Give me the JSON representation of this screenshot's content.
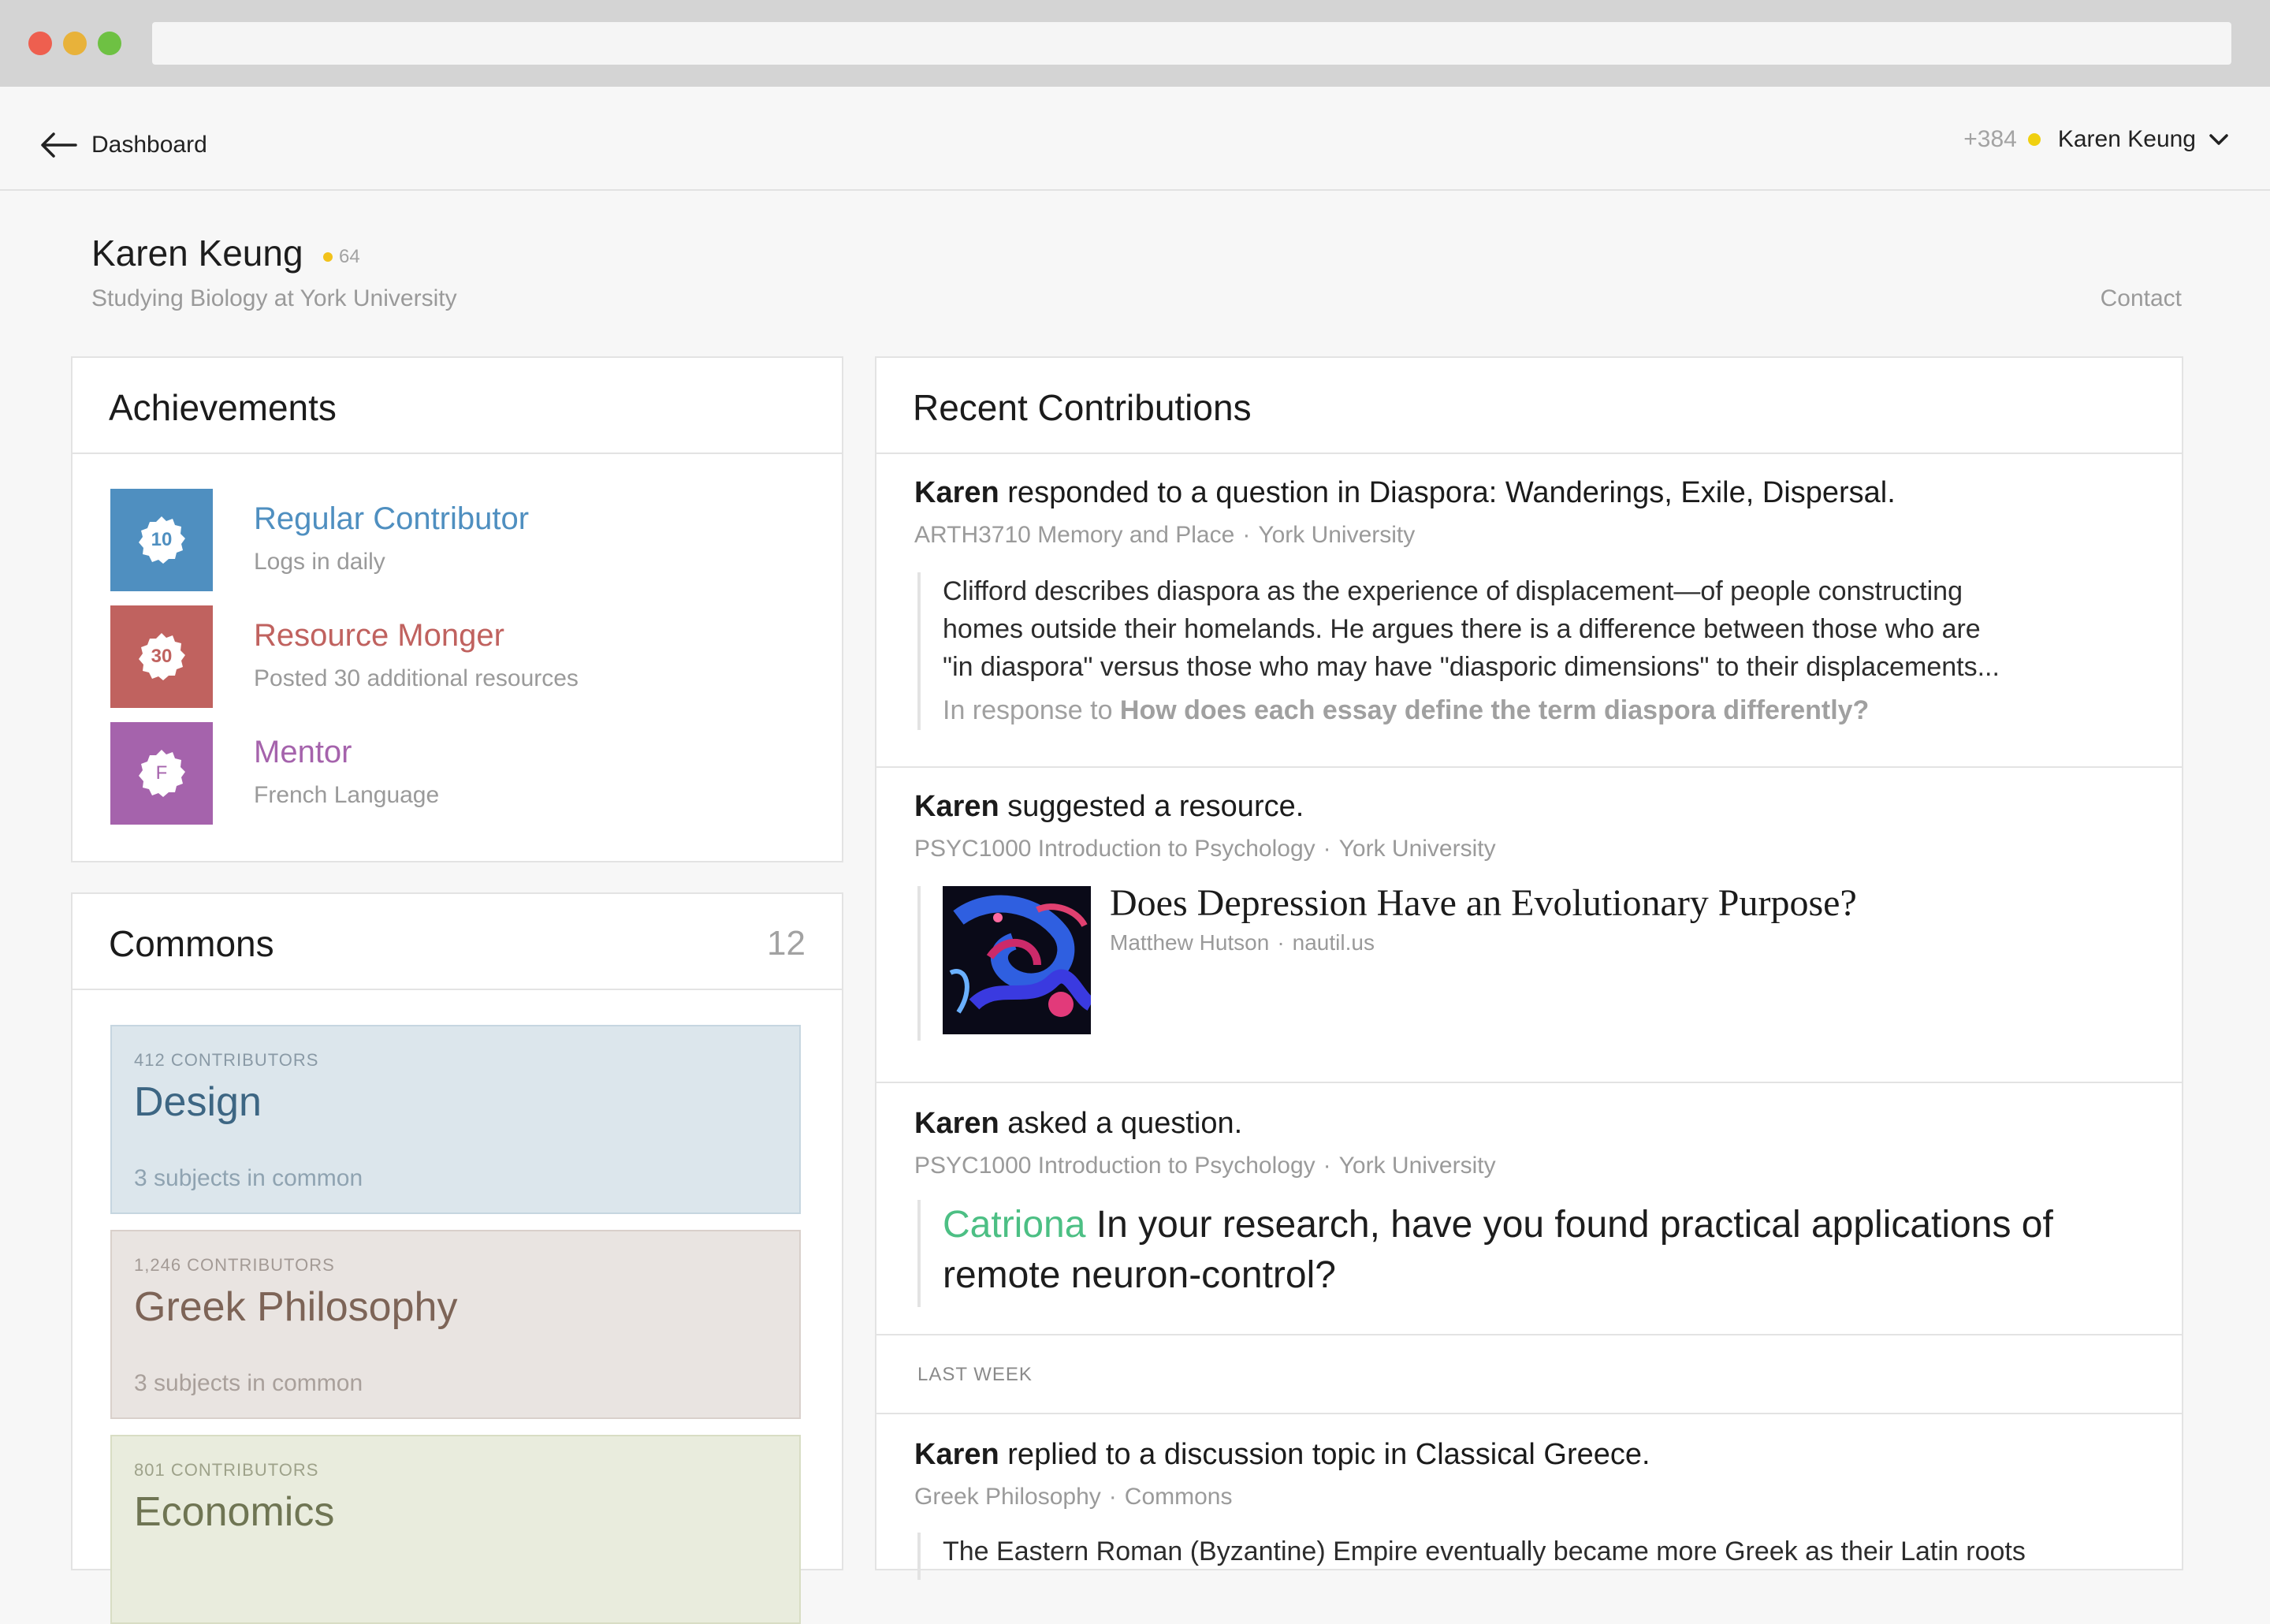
{
  "nav": {
    "back_label": "Dashboard",
    "points": "+384",
    "user_name": "Karen Keung"
  },
  "profile": {
    "name": "Karen Keung",
    "score": "64",
    "subtitle": "Studying Biology at York University",
    "contact_label": "Contact"
  },
  "achievements": {
    "title": "Achievements",
    "items": [
      {
        "badge": "10",
        "title": "Regular Contributor",
        "desc": "Logs in daily",
        "color": "#4f8fc0"
      },
      {
        "badge": "30",
        "title": "Resource Monger",
        "desc": "Posted 30 additional resources",
        "color": "#c0625f"
      },
      {
        "badge": "F",
        "title": "Mentor",
        "desc": "French Language",
        "color": "#a563ac"
      }
    ]
  },
  "commons": {
    "title": "Commons",
    "count": "12",
    "items": [
      {
        "contributors": "412 CONTRIBUTORS",
        "name": "Design",
        "sub": "3 subjects in common",
        "bg": "#dce6ec",
        "border": "#c6d6e0",
        "fg": "#3d6683"
      },
      {
        "contributors": "1,246 CONTRIBUTORS",
        "name": "Greek Philosophy",
        "sub": "3 subjects in common",
        "bg": "#e9e4e1",
        "border": "#d9d0cb",
        "fg": "#7d6457"
      },
      {
        "contributors": "801 CONTRIBUTORS",
        "name": "Economics",
        "sub": "",
        "bg": "#e9ecdd",
        "border": "#d8ddc4",
        "fg": "#6f7553"
      }
    ]
  },
  "contributions": {
    "title": "Recent Contributions",
    "item1": {
      "actor": "Karen",
      "action": " responded to a question in Diaspora: Wanderings, Exile, Dispersal.",
      "course": "ARTH3710 Memory and Place",
      "school": "York University",
      "quote_lines": [
        "Clifford describes diaspora as the experience of displacement—of people constructing",
        "homes outside their homelands. He argues there is a difference between those who are",
        "\"in diaspora\" versus those who may have \"diasporic dimensions\" to their displacements..."
      ],
      "response_prefix": "In response to ",
      "response_question": "How does each essay define the term diaspora differently?"
    },
    "item2": {
      "actor": "Karen",
      "action": " suggested a resource.",
      "course": "PSYC1000 Introduction to Psychology",
      "school": "York University",
      "resource_title": "Does Depression Have an Evolutionary Purpose?",
      "resource_author": "Matthew Hutson",
      "resource_source": "nautil.us"
    },
    "item3": {
      "actor": "Karen",
      "action": " asked a question.",
      "course": "PSYC1000 Introduction to Psychology",
      "school": "York University",
      "asker": "Catriona",
      "question_line1": " In your research, have you found practical applications of",
      "question_line2": "remote neuron-control?"
    },
    "section_label": "LAST WEEK",
    "item4": {
      "actor": "Karen",
      "action": " replied to a discussion topic in Classical Greece.",
      "course": "Greek Philosophy",
      "school": "Commons",
      "quote_preview": "The Eastern Roman (Byzantine) Empire eventually became more Greek as their Latin roots"
    }
  },
  "separator": "·"
}
